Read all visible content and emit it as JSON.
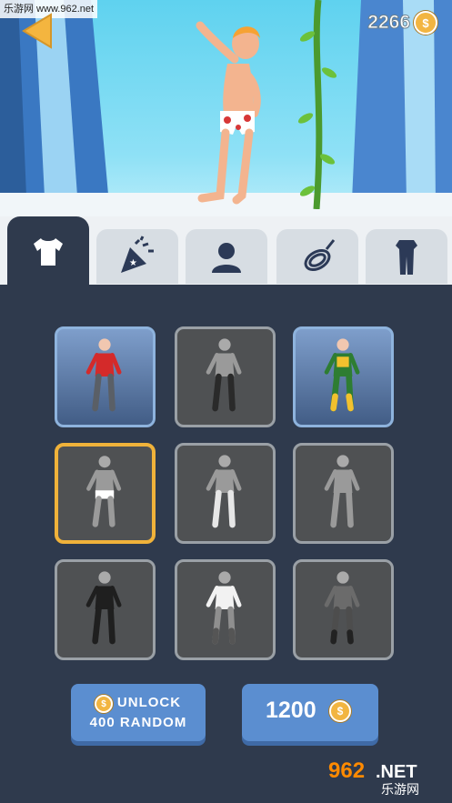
{
  "watermark_top": "乐游网 www.962.net",
  "header": {
    "coin_count": "2266",
    "coin_symbol": "$"
  },
  "tabs": [
    {
      "id": "shirt",
      "icon": "tshirt-icon",
      "active": true
    },
    {
      "id": "celebration",
      "icon": "party-popper-icon",
      "active": false
    },
    {
      "id": "character",
      "icon": "person-silhouette-icon",
      "active": false
    },
    {
      "id": "rope",
      "icon": "rope-icon",
      "active": false
    },
    {
      "id": "outfit",
      "icon": "full-outfit-icon",
      "active": false
    }
  ],
  "skins": [
    {
      "name": "red-shirt",
      "state": "owned"
    },
    {
      "name": "locked-1",
      "state": "locked"
    },
    {
      "name": "green-yellow-suit",
      "state": "owned"
    },
    {
      "name": "underwear",
      "state": "selected"
    },
    {
      "name": "locked-5",
      "state": "locked"
    },
    {
      "name": "locked-6",
      "state": "locked"
    },
    {
      "name": "dark-suit",
      "state": "locked"
    },
    {
      "name": "white-vest",
      "state": "locked"
    },
    {
      "name": "camo-suit",
      "state": "locked"
    }
  ],
  "unlock_button": {
    "line1": "UNLOCK",
    "line2": "400  RANDOM",
    "coin_symbol": "$"
  },
  "buy_button": {
    "price": "1200",
    "coin_symbol": "$"
  },
  "logo": {
    "big": "962",
    "dot_net": ".NET",
    "cn": "乐游网"
  },
  "colors": {
    "sky": "#5fd2ef",
    "panel": "#2f3a4d",
    "accent": "#5b8ed0",
    "coin": "#f2b541",
    "selected_border": "#f0b23a"
  }
}
